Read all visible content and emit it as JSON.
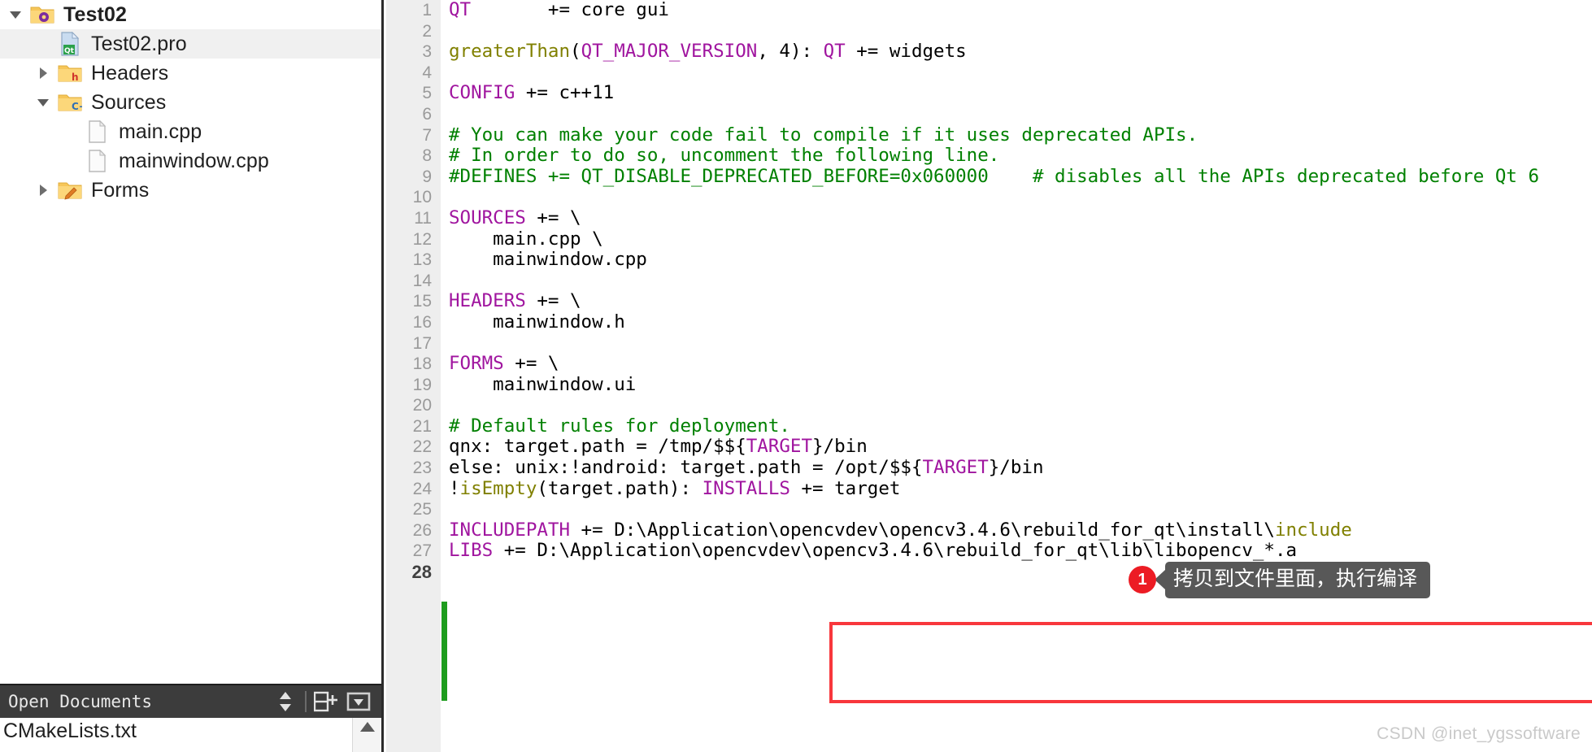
{
  "colors": {
    "keyword": "#a0159f",
    "function": "#808000",
    "comment": "#008000",
    "plain": "#000000",
    "gutter_bg": "#eeeeee",
    "gutter_text": "#9a9a9a",
    "selection_bg": "#f0f0f0",
    "change_bar": "#1d9c1d",
    "highlight_box": "#f8373c",
    "callout_bg": "#585858",
    "badge_bg": "#ec1c24",
    "toolbar_bg": "#3c3c3c",
    "watermark": "#c9c9c9"
  },
  "sidebar": {
    "tree": [
      {
        "label": "Test02",
        "depth": 0,
        "arrow": "down",
        "icon": "project-folder-icon",
        "bold": true,
        "selected": false
      },
      {
        "label": "Test02.pro",
        "depth": 1,
        "arrow": "none",
        "icon": "qt-pro-file-icon",
        "bold": false,
        "selected": true
      },
      {
        "label": "Headers",
        "depth": 1,
        "arrow": "right",
        "icon": "headers-folder-icon",
        "bold": false,
        "selected": false
      },
      {
        "label": "Sources",
        "depth": 1,
        "arrow": "down",
        "icon": "sources-folder-icon",
        "bold": false,
        "selected": false
      },
      {
        "label": "main.cpp",
        "depth": 2,
        "arrow": "none",
        "icon": "source-file-icon",
        "bold": false,
        "selected": false
      },
      {
        "label": "mainwindow.cpp",
        "depth": 2,
        "arrow": "none",
        "icon": "source-file-icon",
        "bold": false,
        "selected": false
      },
      {
        "label": "Forms",
        "depth": 1,
        "arrow": "right",
        "icon": "forms-folder-icon",
        "bold": false,
        "selected": false
      }
    ],
    "open_documents": {
      "title": "Open Documents",
      "items": [
        {
          "label": "CMakeLists.txt"
        }
      ]
    }
  },
  "editor": {
    "lines": [
      {
        "n": "1",
        "current": false,
        "tokens": [
          {
            "t": "QT",
            "c": "kw"
          },
          {
            "t": "       += core gui",
            "c": "pl"
          }
        ]
      },
      {
        "n": "2",
        "current": false,
        "tokens": []
      },
      {
        "n": "3",
        "current": false,
        "tokens": [
          {
            "t": "greaterThan",
            "c": "fn"
          },
          {
            "t": "(",
            "c": "pl"
          },
          {
            "t": "QT_MAJOR_VERSION",
            "c": "kw"
          },
          {
            "t": ", 4): ",
            "c": "pl"
          },
          {
            "t": "QT",
            "c": "kw"
          },
          {
            "t": " += widgets",
            "c": "pl"
          }
        ]
      },
      {
        "n": "4",
        "current": false,
        "tokens": []
      },
      {
        "n": "5",
        "current": false,
        "tokens": [
          {
            "t": "CONFIG",
            "c": "kw"
          },
          {
            "t": " += c++11",
            "c": "pl"
          }
        ]
      },
      {
        "n": "6",
        "current": false,
        "tokens": []
      },
      {
        "n": "7",
        "current": false,
        "tokens": [
          {
            "t": "# You can make your code fail to compile if it uses deprecated APIs.",
            "c": "cm"
          }
        ]
      },
      {
        "n": "8",
        "current": false,
        "tokens": [
          {
            "t": "# In order to do so, uncomment the following line.",
            "c": "cm"
          }
        ]
      },
      {
        "n": "9",
        "current": false,
        "tokens": [
          {
            "t": "#DEFINES += QT_DISABLE_DEPRECATED_BEFORE=0x060000",
            "c": "cm"
          },
          {
            "t": "    ",
            "c": "pl"
          },
          {
            "t": "# disables all the APIs deprecated before Qt 6",
            "c": "cm"
          }
        ]
      },
      {
        "n": "10",
        "current": false,
        "tokens": []
      },
      {
        "n": "11",
        "current": false,
        "tokens": [
          {
            "t": "SOURCES",
            "c": "kw"
          },
          {
            "t": " += \\",
            "c": "pl"
          }
        ]
      },
      {
        "n": "12",
        "current": false,
        "tokens": [
          {
            "t": "    main.cpp \\",
            "c": "pl"
          }
        ]
      },
      {
        "n": "13",
        "current": false,
        "tokens": [
          {
            "t": "    mainwindow.cpp",
            "c": "pl"
          }
        ]
      },
      {
        "n": "14",
        "current": false,
        "tokens": []
      },
      {
        "n": "15",
        "current": false,
        "tokens": [
          {
            "t": "HEADERS",
            "c": "kw"
          },
          {
            "t": " += \\",
            "c": "pl"
          }
        ]
      },
      {
        "n": "16",
        "current": false,
        "tokens": [
          {
            "t": "    mainwindow.h",
            "c": "pl"
          }
        ]
      },
      {
        "n": "17",
        "current": false,
        "tokens": []
      },
      {
        "n": "18",
        "current": false,
        "tokens": [
          {
            "t": "FORMS",
            "c": "kw"
          },
          {
            "t": " += \\",
            "c": "pl"
          }
        ]
      },
      {
        "n": "19",
        "current": false,
        "tokens": [
          {
            "t": "    mainwindow.ui",
            "c": "pl"
          }
        ]
      },
      {
        "n": "20",
        "current": false,
        "tokens": []
      },
      {
        "n": "21",
        "current": false,
        "tokens": [
          {
            "t": "# Default rules for deployment.",
            "c": "cm"
          }
        ]
      },
      {
        "n": "22",
        "current": false,
        "tokens": [
          {
            "t": "qnx: target.path = /tmp/$${",
            "c": "pl"
          },
          {
            "t": "TARGET",
            "c": "kw"
          },
          {
            "t": "}/bin",
            "c": "pl"
          }
        ]
      },
      {
        "n": "23",
        "current": false,
        "tokens": [
          {
            "t": "else: unix:!android: target.path = /opt/$${",
            "c": "pl"
          },
          {
            "t": "TARGET",
            "c": "kw"
          },
          {
            "t": "}/bin",
            "c": "pl"
          }
        ]
      },
      {
        "n": "24",
        "current": false,
        "tokens": [
          {
            "t": "!",
            "c": "pl"
          },
          {
            "t": "isEmpty",
            "c": "fn"
          },
          {
            "t": "(target.path): ",
            "c": "pl"
          },
          {
            "t": "INSTALLS",
            "c": "kw"
          },
          {
            "t": " += target",
            "c": "pl"
          }
        ]
      },
      {
        "n": "25",
        "current": false,
        "tokens": []
      },
      {
        "n": "26",
        "current": false,
        "tokens": [
          {
            "t": "INCLUDEPATH",
            "c": "kw"
          },
          {
            "t": " += D:\\Application\\opencvdev\\opencv3.4.6\\rebuild_for_qt\\install\\",
            "c": "pl"
          },
          {
            "t": "include",
            "c": "fn"
          }
        ]
      },
      {
        "n": "27",
        "current": false,
        "tokens": [
          {
            "t": "LIBS",
            "c": "kw"
          },
          {
            "t": " += D:\\Application\\opencvdev\\opencv3.4.6\\rebuild_for_qt\\lib\\libopencv_*.a",
            "c": "pl"
          }
        ]
      },
      {
        "n": "28",
        "current": true,
        "tokens": []
      }
    ]
  },
  "annotation": {
    "badge": "1",
    "text": "拷贝到文件里面，执行编译"
  },
  "watermark": "CSDN @inet_ygssoftware"
}
